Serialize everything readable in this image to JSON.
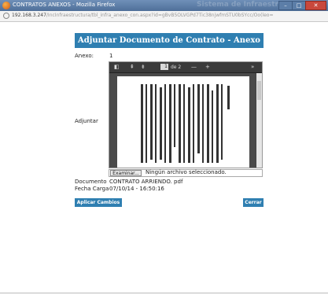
{
  "window": {
    "title": "CONTRATOS ANEXOS - Mozilla Firefox",
    "ghost_title": "Sistema de Infraestruct",
    "min": "–",
    "max": "□",
    "close": "✕"
  },
  "address": {
    "host": "192.168.3.247",
    "path": "/IncInfraestructura/tbl_infra_anexo_con.aspx?id=gBvB5OLVGPd7Tic38njwfmSTU0bSYcc/Oo(leo="
  },
  "header": {
    "title": "Adjuntar Documento de Contrato - Anexo"
  },
  "form": {
    "anexo_label": "Anexo:",
    "anexo_value": "1",
    "adjuntar_label": "Adjuntar",
    "documento_label": "Documento",
    "documento_value": "CONTRATO ARRIENDO. pdf",
    "fecha_label": "Fecha Carga",
    "fecha_value": "07/10/14 - 16:50:16"
  },
  "pdf_viewer": {
    "page_current": "1",
    "page_total": "de 2",
    "zoom_out": "—",
    "zoom_in": "+",
    "more": "»"
  },
  "file_input": {
    "button_label": "Examinar...",
    "status_text": "Ningún archivo seleccionado."
  },
  "buttons": {
    "apply": "Aplicar Cambios",
    "close": "Cerrar"
  },
  "colors": {
    "accent": "#2f7fb1",
    "titlebar": "#4f6f99",
    "close_button": "#c9483c"
  }
}
